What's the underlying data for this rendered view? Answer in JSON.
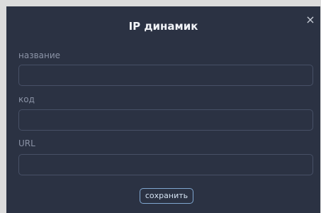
{
  "dialog": {
    "title": "IP динамик",
    "close_icon": "close-icon",
    "fields": [
      {
        "label": "название",
        "value": "",
        "placeholder": ""
      },
      {
        "label": "код",
        "value": "",
        "placeholder": ""
      },
      {
        "label": "URL",
        "value": "",
        "placeholder": ""
      }
    ],
    "save_label": "сохранить"
  }
}
